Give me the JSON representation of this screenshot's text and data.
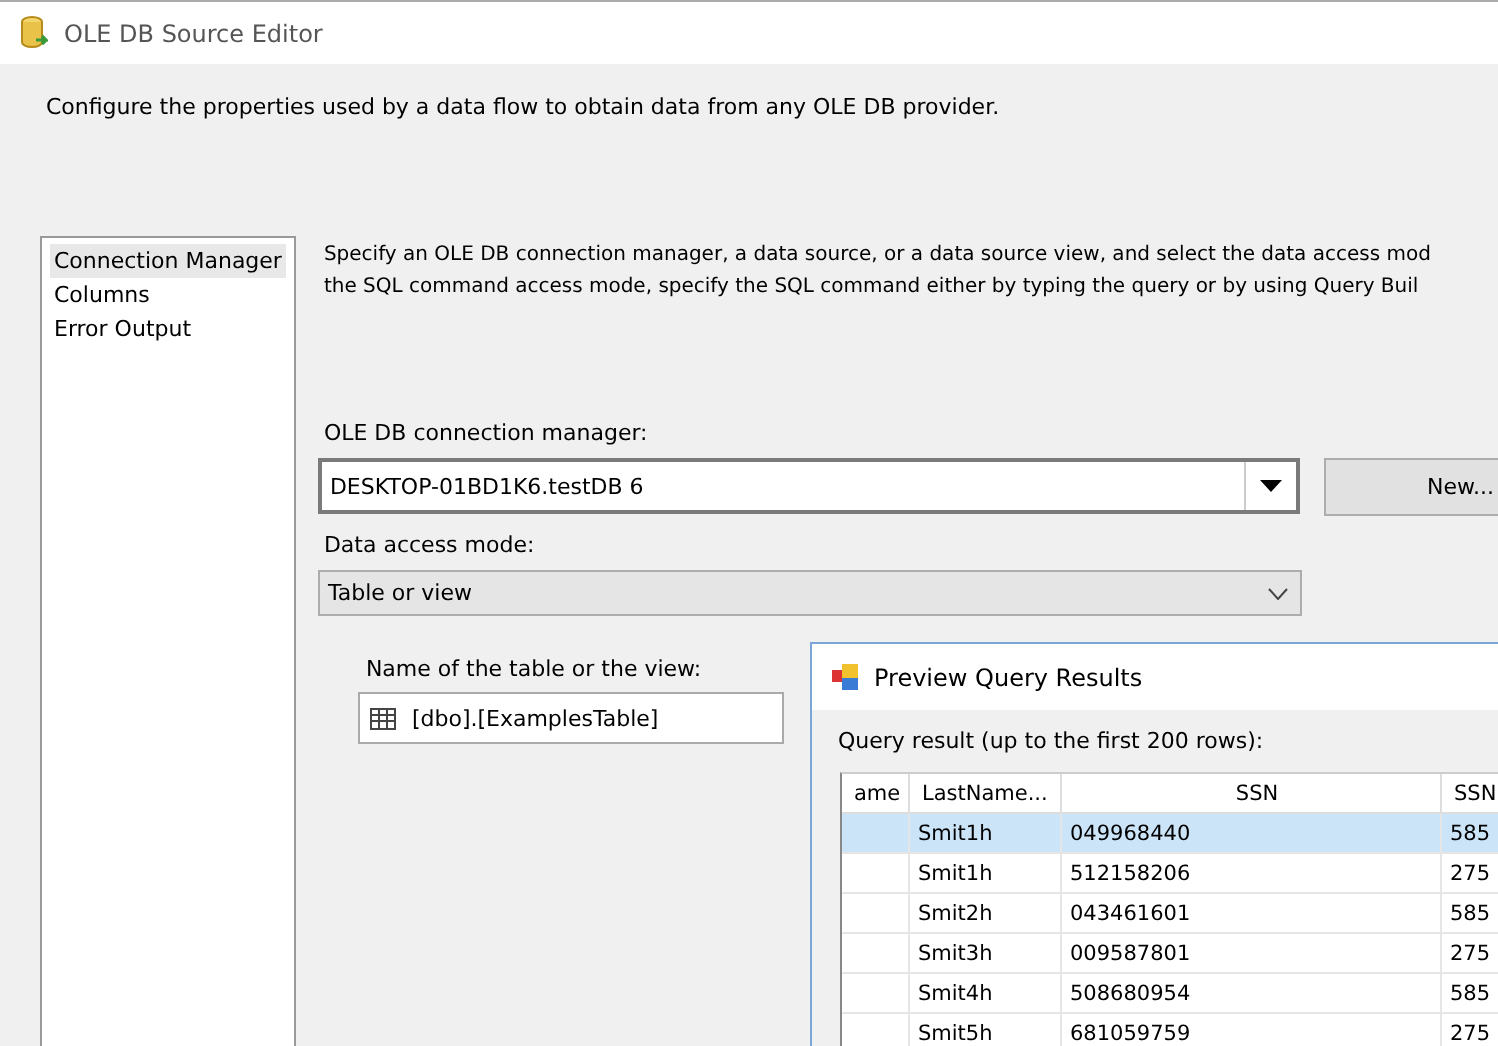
{
  "window": {
    "title": "OLE DB Source Editor"
  },
  "intro": "Configure the properties used by a data flow to obtain data from any OLE DB provider.",
  "sidebar": {
    "items": [
      {
        "label": "Connection Manager",
        "selected": true
      },
      {
        "label": "Columns",
        "selected": false
      },
      {
        "label": "Error Output",
        "selected": false
      }
    ]
  },
  "description": [
    "Specify an OLE DB connection manager, a data source, or a data source view, and select the data access mod",
    "the SQL command access mode, specify the SQL command either by typing the query or by using Query Buil"
  ],
  "connection": {
    "label": "OLE DB connection manager:",
    "value": "DESKTOP-01BD1K6.testDB 6",
    "button": "New..."
  },
  "access_mode": {
    "label": "Data access mode:",
    "value": "Table or view"
  },
  "table_name": {
    "label": "Name of the table or the view:",
    "value": "[dbo].[ExamplesTable]"
  },
  "preview": {
    "title": "Preview Query Results",
    "caption": "Query result (up to the first 200 rows):",
    "columns": [
      "ame",
      "LastName...",
      "SSN",
      "SSN"
    ],
    "rows": [
      {
        "cells": [
          "",
          "Smit1h",
          "049968440",
          "585"
        ],
        "selected": true
      },
      {
        "cells": [
          "",
          "Smit1h",
          "512158206",
          "275"
        ],
        "selected": false
      },
      {
        "cells": [
          "",
          "Smit2h",
          "043461601",
          "585"
        ],
        "selected": false
      },
      {
        "cells": [
          "",
          "Smit3h",
          "009587801",
          "275"
        ],
        "selected": false
      },
      {
        "cells": [
          "",
          "Smit4h",
          "508680954",
          "585"
        ],
        "selected": false
      },
      {
        "cells": [
          "",
          "Smit5h",
          "681059759",
          "275"
        ],
        "selected": false
      }
    ]
  }
}
